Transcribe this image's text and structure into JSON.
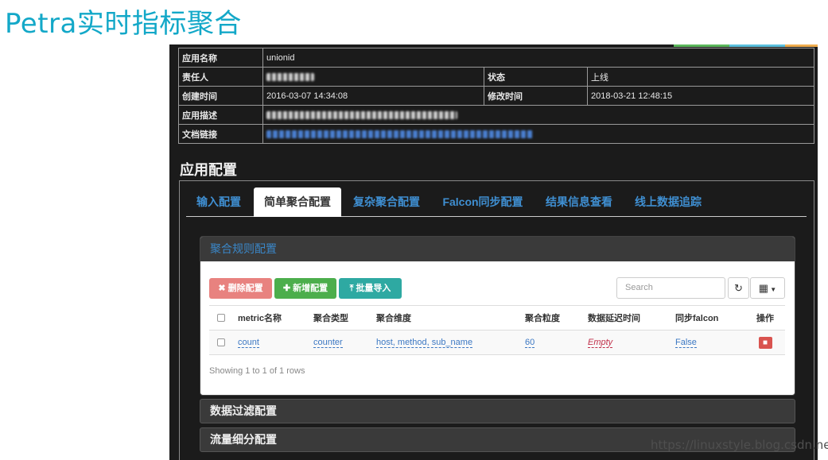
{
  "page_title": "Petra实时指标聚合",
  "info": {
    "app_name_label": "应用名称",
    "app_name_value": "unionid",
    "owner_label": "责任人",
    "status_label": "状态",
    "status_value": "上线",
    "created_label": "创建时间",
    "created_value": "2016-03-07 14:34:08",
    "modified_label": "修改时间",
    "modified_value": "2018-03-21 12:48:15",
    "desc_label": "应用描述",
    "doc_label": "文档链接"
  },
  "section_title": "应用配置",
  "tabs": [
    {
      "label": "输入配置"
    },
    {
      "label": "简单聚合配置"
    },
    {
      "label": "复杂聚合配置"
    },
    {
      "label": "Falcon同步配置"
    },
    {
      "label": "结果信息查看"
    },
    {
      "label": "线上数据追踪"
    }
  ],
  "rules_panel": {
    "heading": "聚合规则配置",
    "delete_label": "删除配置",
    "add_label": "新增配置",
    "import_label": "批量导入",
    "search_placeholder": "Search",
    "columns": [
      "metric名称",
      "聚合类型",
      "聚合维度",
      "聚合粒度",
      "数据延迟时间",
      "同步falcon",
      "操作"
    ],
    "rows": [
      {
        "metric": "count",
        "agg_type": "counter",
        "dimensions": "host, method, sub_name",
        "granularity": "60",
        "delay": "Empty",
        "sync_falcon": "False"
      }
    ],
    "pagination_info": "Showing 1 to 1 of 1 rows"
  },
  "filter_panel_label": "数据过滤配置",
  "traffic_panel_label": "流量细分配置",
  "watermark": "https://linuxstyle.blog.csdn.net",
  "icons": {
    "delete": "times-icon",
    "add": "plus-icon",
    "import": "upload-icon",
    "refresh": "refresh-icon",
    "columns": "grid-icon",
    "trash": "trash-icon"
  },
  "colors": {
    "title": "#13a8c8",
    "tab_link": "#3f8fd2",
    "danger": "#d9534f",
    "success": "#4cae4c",
    "info": "#2ea9a2"
  }
}
